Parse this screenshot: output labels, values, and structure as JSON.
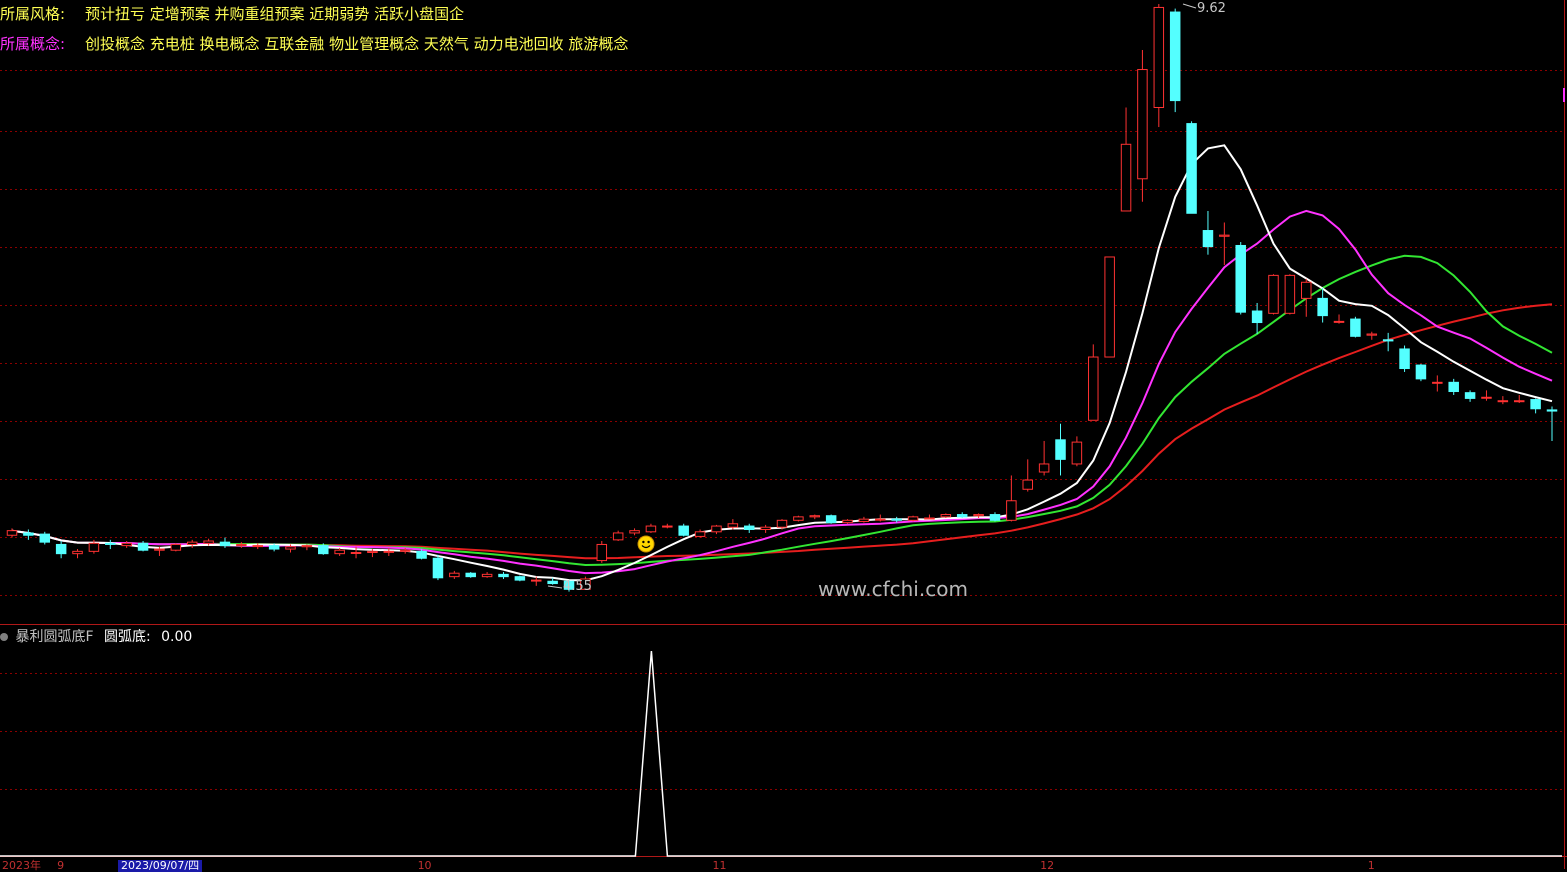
{
  "header": {
    "style_label": "所属风格:",
    "style_text": "预计扭亏 定增预案 并购重组预案 近期弱势 活跃小盘国企",
    "concept_label": "所属概念:",
    "concept_text": "创投概念 充电桩 换电概念 互联金融 物业管理概念 天然气 动力电池回收 旅游概念"
  },
  "indicator": {
    "name": "暴利圆弧底F",
    "series_label": "圆弧底:",
    "series_value": "0.00"
  },
  "price_labels": {
    "high": "9.62",
    "low": "4.55"
  },
  "watermark": "www.cfchi.com",
  "axis": {
    "cursor_date": "2023/09/07/四",
    "year_label": "2023年",
    "month_labels": [
      "9",
      "10",
      "11",
      "12",
      "1"
    ]
  },
  "colors": {
    "up": "#ff3232",
    "down": "#54ffff",
    "ma_white": "#ffffff",
    "ma_magenta": "#ff32ff",
    "ma_green": "#32e632",
    "ma_red": "#e61e1e",
    "grid": "#8b0000",
    "label_style": "#ffff54",
    "label_concept": "#ff32ff",
    "style_label_color": "#ffff54"
  },
  "chart_data": [
    {
      "type": "candlestick",
      "title": "",
      "ylim": [
        4.2,
        9.8
      ],
      "series": [
        {
          "name": "",
          "candles": [
            [
              5.0,
              5.04,
              5.06,
              4.98
            ],
            [
              5.02,
              5.0,
              5.05,
              4.96
            ],
            [
              5.01,
              4.94,
              5.03,
              4.92
            ],
            [
              4.92,
              4.84,
              4.95,
              4.8
            ],
            [
              4.84,
              4.86,
              4.88,
              4.8
            ],
            [
              4.86,
              4.93,
              4.96,
              4.84
            ],
            [
              4.93,
              4.92,
              4.96,
              4.88
            ],
            [
              4.91,
              4.93,
              4.95,
              4.89
            ],
            [
              4.93,
              4.87,
              4.95,
              4.86
            ],
            [
              4.87,
              4.88,
              4.9,
              4.82
            ],
            [
              4.87,
              4.92,
              4.93,
              4.86
            ],
            [
              4.92,
              4.94,
              4.96,
              4.89
            ],
            [
              4.93,
              4.95,
              4.97,
              4.91
            ],
            [
              4.94,
              4.91,
              4.98,
              4.89
            ],
            [
              4.91,
              4.92,
              4.94,
              4.89
            ],
            [
              4.91,
              4.91,
              4.93,
              4.88
            ],
            [
              4.91,
              4.88,
              4.93,
              4.86
            ],
            [
              4.88,
              4.9,
              4.92,
              4.85
            ],
            [
              4.9,
              4.91,
              4.92,
              4.87
            ],
            [
              4.91,
              4.84,
              4.93,
              4.83
            ],
            [
              4.84,
              4.87,
              4.89,
              4.82
            ],
            [
              4.85,
              4.85,
              4.9,
              4.8
            ],
            [
              4.85,
              4.86,
              4.88,
              4.81
            ],
            [
              4.86,
              4.86,
              4.89,
              4.82
            ],
            [
              4.86,
              4.87,
              4.89,
              4.84
            ],
            [
              4.86,
              4.8,
              4.88,
              4.79
            ],
            [
              4.8,
              4.63,
              4.83,
              4.61
            ],
            [
              4.64,
              4.67,
              4.69,
              4.62
            ],
            [
              4.67,
              4.64,
              4.68,
              4.63
            ],
            [
              4.64,
              4.66,
              4.68,
              4.63
            ],
            [
              4.66,
              4.64,
              4.68,
              4.62
            ],
            [
              4.64,
              4.61,
              4.65,
              4.6
            ],
            [
              4.61,
              4.61,
              4.64,
              4.56
            ],
            [
              4.6,
              4.58,
              4.63,
              4.57
            ],
            [
              4.6,
              4.53,
              4.61,
              4.51
            ],
            [
              4.53,
              4.62,
              4.64,
              4.55
            ],
            [
              4.78,
              4.92,
              4.95,
              4.76
            ],
            [
              4.96,
              5.02,
              5.04,
              4.95
            ],
            [
              5.02,
              5.04,
              5.06,
              5.0
            ],
            [
              5.03,
              5.08,
              5.1,
              5.02
            ],
            [
              5.08,
              5.08,
              5.1,
              5.06
            ],
            [
              5.08,
              5.0,
              5.1,
              4.99
            ],
            [
              4.99,
              5.03,
              5.05,
              4.98
            ],
            [
              5.03,
              5.08,
              5.09,
              5.01
            ],
            [
              5.07,
              5.1,
              5.14,
              5.05
            ],
            [
              5.08,
              5.05,
              5.1,
              5.02
            ],
            [
              5.05,
              5.07,
              5.09,
              5.02
            ],
            [
              5.07,
              5.13,
              5.14,
              5.05
            ],
            [
              5.13,
              5.16,
              5.17,
              5.12
            ],
            [
              5.16,
              5.17,
              5.18,
              5.14
            ],
            [
              5.17,
              5.11,
              5.18,
              5.1
            ],
            [
              5.11,
              5.13,
              5.14,
              5.1
            ],
            [
              5.12,
              5.14,
              5.16,
              5.11
            ],
            [
              5.14,
              5.14,
              5.18,
              5.12
            ],
            [
              5.14,
              5.13,
              5.16,
              5.11
            ],
            [
              5.13,
              5.16,
              5.17,
              5.12
            ],
            [
              5.15,
              5.15,
              5.18,
              5.14
            ],
            [
              5.16,
              5.18,
              5.19,
              5.15
            ],
            [
              5.18,
              5.16,
              5.2,
              5.15
            ],
            [
              5.17,
              5.18,
              5.19,
              5.15
            ],
            [
              5.18,
              5.13,
              5.2,
              5.12
            ],
            [
              5.13,
              5.3,
              5.52,
              5.12
            ],
            [
              5.4,
              5.48,
              5.66,
              5.38
            ],
            [
              5.55,
              5.62,
              5.82,
              5.52
            ],
            [
              5.83,
              5.66,
              5.97,
              5.52
            ],
            [
              5.62,
              5.81,
              5.86,
              5.6
            ],
            [
              6.0,
              6.55,
              6.66,
              6.0
            ],
            [
              6.55,
              7.42,
              7.42,
              6.55
            ],
            [
              7.82,
              8.4,
              8.72,
              7.82
            ],
            [
              8.1,
              9.05,
              9.22,
              7.9
            ],
            [
              8.72,
              9.59,
              9.62,
              8.55
            ],
            [
              9.55,
              8.78,
              9.58,
              8.68
            ],
            [
              8.58,
              7.8,
              8.6,
              7.8
            ],
            [
              7.65,
              7.51,
              7.82,
              7.44
            ],
            [
              7.6,
              7.61,
              7.72,
              7.35
            ],
            [
              7.52,
              6.94,
              7.55,
              6.92
            ],
            [
              6.95,
              6.85,
              7.02,
              6.75
            ],
            [
              6.93,
              7.26,
              7.27,
              6.92
            ],
            [
              6.93,
              7.26,
              7.27,
              6.92
            ],
            [
              7.06,
              7.2,
              7.23,
              6.9
            ],
            [
              7.06,
              6.91,
              7.15,
              6.85
            ],
            [
              6.86,
              6.86,
              6.92,
              6.84
            ],
            [
              6.88,
              6.73,
              6.9,
              6.72
            ],
            [
              6.74,
              6.75,
              6.77,
              6.7
            ],
            [
              6.7,
              6.69,
              6.76,
              6.6
            ],
            [
              6.62,
              6.45,
              6.65,
              6.42
            ],
            [
              6.48,
              6.36,
              6.49,
              6.34
            ],
            [
              6.33,
              6.33,
              6.39,
              6.25
            ],
            [
              6.33,
              6.25,
              6.36,
              6.22
            ],
            [
              6.24,
              6.19,
              6.26,
              6.16
            ],
            [
              6.2,
              6.2,
              6.26,
              6.17
            ],
            [
              6.17,
              6.17,
              6.21,
              6.14
            ],
            [
              6.17,
              6.17,
              6.22,
              6.15
            ],
            [
              6.18,
              6.1,
              6.19,
              6.06
            ],
            [
              6.09,
              6.08,
              6.12,
              5.82
            ]
          ]
        }
      ]
    },
    {
      "type": "line",
      "title": "",
      "ylim": [
        0,
        1
      ],
      "series": [
        {
          "name": "圆弧底",
          "values": [
            0,
            0,
            0,
            0,
            0,
            0,
            0,
            0,
            0,
            0,
            0,
            0,
            0,
            0,
            0,
            0,
            0,
            0,
            0,
            0,
            0,
            0,
            0,
            0,
            0,
            0,
            0,
            0,
            0,
            0,
            0,
            0,
            0,
            0,
            0,
            0,
            0,
            0,
            0,
            0,
            0,
            0,
            0,
            0,
            0,
            0,
            0,
            0,
            0,
            0,
            0,
            0,
            0,
            0,
            0,
            0,
            0,
            0,
            0,
            0,
            0,
            0,
            0,
            0,
            0,
            0,
            0,
            0,
            0,
            0,
            0,
            0,
            0,
            0,
            0,
            0,
            0,
            0,
            0,
            0,
            0,
            0,
            0,
            0,
            0,
            0,
            0,
            0,
            0,
            0,
            0,
            0,
            0,
            0,
            0
          ],
          "spike_index": 39,
          "spike_value": 1
        }
      ]
    }
  ]
}
